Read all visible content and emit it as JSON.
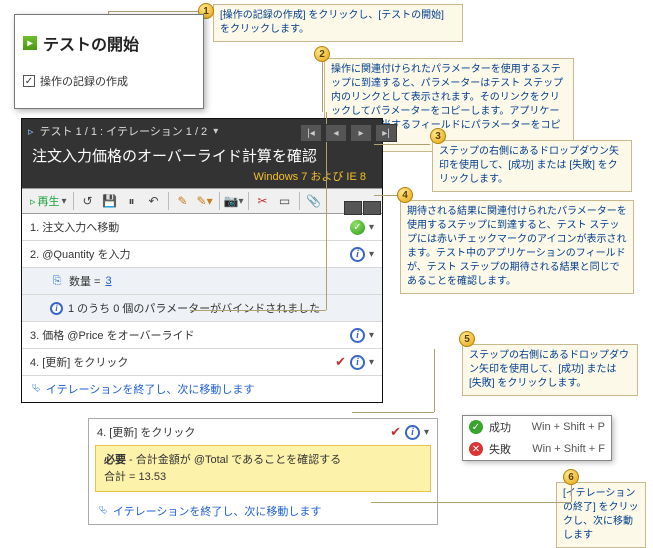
{
  "popup": {
    "title": "テストの開始",
    "checkbox": "操作の記録の作成"
  },
  "runner": {
    "location": "テスト 1 / 1 : イテレーション 1 / 2",
    "title": "注文入力価格のオーバーライド計算を確認",
    "env": "Windows 7 および IE 8",
    "play": "再生"
  },
  "steps": [
    {
      "n": "1.",
      "t": "注文入力へ移動"
    },
    {
      "n": "2.",
      "t": "@Quantity を入力"
    },
    {
      "sub_qty_label": "数量 = ",
      "sub_qty_val": "3"
    },
    {
      "sub_info": "1 のうち 0 個のパラメーターがバインドされました"
    },
    {
      "n": "3.",
      "t": "価格 @Price をオーバーライド"
    },
    {
      "n": "4.",
      "t": "[更新] をクリック"
    }
  ],
  "footer_link": "イテレーションを終了し、次に移動します",
  "detail": {
    "head": "4. [更新] をクリック",
    "must_label": "必要",
    "must_text": " - 合計金額が @Total であることを確認する",
    "total": "合計 = 13.53",
    "foot": "イテレーションを終了し、次に移動します"
  },
  "pfmenu": {
    "pass": "成功",
    "pass_sc": "Win + Shift + P",
    "fail": "失敗",
    "fail_sc": "Win + Shift + F"
  },
  "callouts": {
    "1": "[操作の記録の作成] をクリックし、[テストの開始] をクリックします。",
    "2": "操作に関連付けられたパラメーターを使用するステップに到達すると、パラメーターはテスト ステップ内のリンクとして表示されます。そのリンクをクリックしてパラメーターをコピーします。アプリケーションの該当するフィールドにパラメーターをコピーできます。",
    "3": "ステップの右側にあるドロップダウン矢印を使用して、[成功] または [失敗] をクリックします。",
    "4": "期待される結果に関連付けられたパラメーターを使用するステップに到達すると、テスト ステップには赤いチェックマークのアイコンが表示されます。テスト中のアプリケーションのフィールドが、テスト ステップの期待される結果と同じであることを確認します。",
    "5": "ステップの右側にあるドロップダウン矢印を使用して、[成功] または [失敗] をクリックします。",
    "6": "[イテレーションの終了] をクリックし、次に移動します"
  }
}
